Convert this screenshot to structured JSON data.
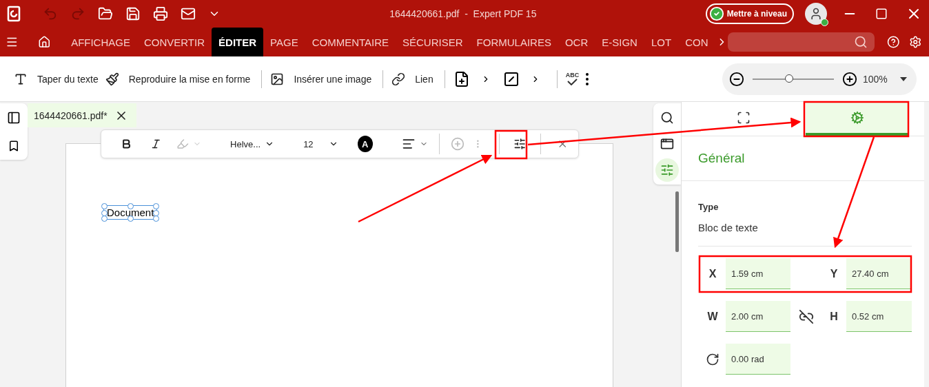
{
  "title_bar": {
    "title": "1644420661.pdf  -  Expert PDF 15",
    "upgrade_button": "Mettre à niveau"
  },
  "menu_tabs": [
    {
      "label": "AFFICHAGE",
      "selected": false
    },
    {
      "label": "CONVERTIR",
      "selected": false
    },
    {
      "label": "ÉDITER",
      "selected": true
    },
    {
      "label": "PAGE",
      "selected": false
    },
    {
      "label": "COMMENTAIRE",
      "selected": false
    },
    {
      "label": "SÉCURISER",
      "selected": false
    },
    {
      "label": "FORMULAIRES",
      "selected": false
    },
    {
      "label": "OCR",
      "selected": false
    },
    {
      "label": "E-SIGN",
      "selected": false
    },
    {
      "label": "LOT",
      "selected": false
    },
    {
      "label": "CON",
      "selected": false
    }
  ],
  "ribbon": [
    {
      "kind": "type-text",
      "label": "Taper du texte"
    },
    {
      "kind": "format-painter",
      "label": "Reproduire la mise en forme"
    },
    {
      "kind": "image",
      "label": "Insérer une image"
    },
    {
      "kind": "link",
      "label": "Lien"
    },
    {
      "kind": "add-page"
    },
    {
      "kind": "crop"
    },
    {
      "kind": "spellcheck",
      "label": "ABC"
    },
    {
      "kind": "more"
    }
  ],
  "zoom": {
    "level": 0.45,
    "reading": "100%"
  },
  "doc_tab": {
    "label": "1644420661.pdf*",
    "selected": true
  },
  "format_toolbar": [
    {
      "kind": "bold",
      "disabled": false
    },
    {
      "kind": "italic",
      "disabled": false
    },
    {
      "kind": "highlighter",
      "disabled": true
    },
    {
      "kind": "font",
      "text": "Helve...",
      "disabled": false
    },
    {
      "kind": "size",
      "text": "12",
      "disabled": false
    },
    {
      "kind": "color",
      "text": "A",
      "disabled": false
    },
    {
      "kind": "align",
      "disabled": false
    },
    {
      "kind": "add",
      "disabled": true
    },
    {
      "kind": "properties",
      "disabled": false
    },
    {
      "kind": "close",
      "disabled": false
    }
  ],
  "text_block": "Document",
  "side_strip": [
    {
      "kind": "search",
      "selected": false
    },
    {
      "kind": "panel",
      "selected": false
    },
    {
      "kind": "properties",
      "selected": true
    }
  ],
  "panel": {
    "tabs": [
      {
        "kind": "text-style",
        "selected": false
      },
      {
        "kind": "settings",
        "selected": true
      }
    ],
    "section": "Général",
    "type_label": "Type",
    "type_value": "Bloc de texte",
    "fields": [
      {
        "kind": "letter",
        "label": "X",
        "value": "1.59 cm"
      },
      {
        "kind": "letter",
        "label": "Y",
        "value": "27.40 cm"
      },
      {
        "kind": "letter",
        "label": "W",
        "value": "2.00 cm"
      },
      {
        "kind": "letter",
        "label": "H",
        "value": "0.52 cm"
      },
      {
        "kind": "rotation",
        "value": "0.00 rad"
      }
    ]
  }
}
